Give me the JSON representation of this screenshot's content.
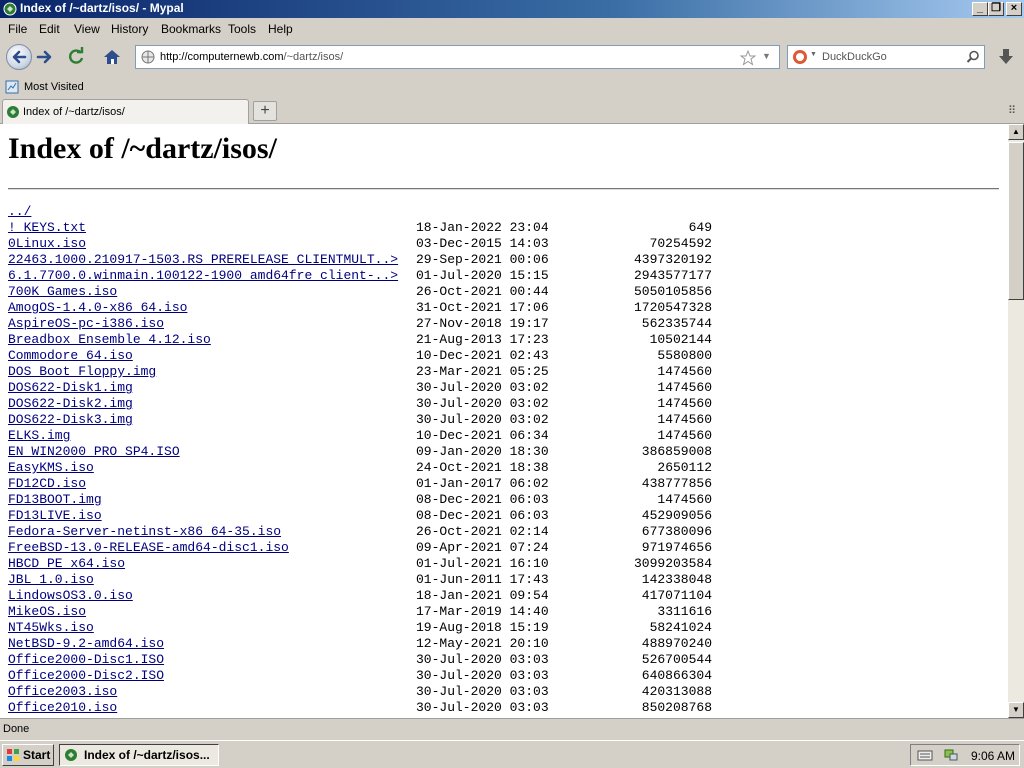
{
  "window": {
    "title": "Index of /~dartz/isos/ - Mypal"
  },
  "menu": [
    "File",
    "Edit",
    "View",
    "History",
    "Bookmarks",
    "Tools",
    "Help"
  ],
  "nav": {
    "url_host": "http://computernewb.com",
    "url_path": "/~dartz/isos/",
    "search_placeholder": "DuckDuckGo"
  },
  "bookmarks_bar": {
    "most_visited": "Most Visited"
  },
  "tab": {
    "title": "Index of /~dartz/isos/"
  },
  "page": {
    "heading": "Index of /~dartz/isos/",
    "parent_link": "../",
    "files": [
      {
        "name": "! KEYS.txt",
        "date": "18-Jan-2022 23:04",
        "size": "649"
      },
      {
        "name": "0Linux.iso",
        "date": "03-Dec-2015 14:03",
        "size": "70254592"
      },
      {
        "name": "22463.1000.210917-1503.RS_PRERELEASE_CLIENTMULT..>",
        "date": "29-Sep-2021 00:06",
        "size": "4397320192"
      },
      {
        "name": "6.1.7700.0.winmain.100122-1900_amd64fre_client-..>",
        "date": "01-Jul-2020 15:15",
        "size": "2943577177"
      },
      {
        "name": "700K Games.iso",
        "date": "26-Oct-2021 00:44",
        "size": "5050105856"
      },
      {
        "name": "AmogOS-1.4.0-x86_64.iso",
        "date": "31-Oct-2021 17:06",
        "size": "1720547328"
      },
      {
        "name": "AspireOS-pc-i386.iso",
        "date": "27-Nov-2018 19:17",
        "size": "562335744"
      },
      {
        "name": "Breadbox Ensemble 4.12.iso",
        "date": "21-Aug-2013 17:23",
        "size": "10502144"
      },
      {
        "name": "Commodore 64.iso",
        "date": "10-Dec-2021 02:43",
        "size": "5580800"
      },
      {
        "name": "DOS Boot Floppy.img",
        "date": "23-Mar-2021 05:25",
        "size": "1474560"
      },
      {
        "name": "DOS622-Disk1.img",
        "date": "30-Jul-2020 03:02",
        "size": "1474560"
      },
      {
        "name": "DOS622-Disk2.img",
        "date": "30-Jul-2020 03:02",
        "size": "1474560"
      },
      {
        "name": "DOS622-Disk3.img",
        "date": "30-Jul-2020 03:02",
        "size": "1474560"
      },
      {
        "name": "ELKS.img",
        "date": "10-Dec-2021 06:34",
        "size": "1474560"
      },
      {
        "name": "EN_WIN2000_PRO_SP4.ISO",
        "date": "09-Jan-2020 18:30",
        "size": "386859008"
      },
      {
        "name": "EasyKMS.iso",
        "date": "24-Oct-2021 18:38",
        "size": "2650112"
      },
      {
        "name": "FD12CD.iso",
        "date": "01-Jan-2017 06:02",
        "size": "438777856"
      },
      {
        "name": "FD13BOOT.img",
        "date": "08-Dec-2021 06:03",
        "size": "1474560"
      },
      {
        "name": "FD13LIVE.iso",
        "date": "08-Dec-2021 06:03",
        "size": "452909056"
      },
      {
        "name": "Fedora-Server-netinst-x86_64-35.iso",
        "date": "26-Oct-2021 02:14",
        "size": "677380096"
      },
      {
        "name": "FreeBSD-13.0-RELEASE-amd64-disc1.iso",
        "date": "09-Apr-2021 07:24",
        "size": "971974656"
      },
      {
        "name": "HBCD_PE_x64.iso",
        "date": "01-Jul-2021 16:10",
        "size": "3099203584"
      },
      {
        "name": "JBL 1.0.iso",
        "date": "01-Jun-2011 17:43",
        "size": "142338048"
      },
      {
        "name": "LindowsOS3.0.iso",
        "date": "18-Jan-2021 09:54",
        "size": "417071104"
      },
      {
        "name": "MikeOS.iso",
        "date": "17-Mar-2019 14:40",
        "size": "3311616"
      },
      {
        "name": "NT45Wks.iso",
        "date": "19-Aug-2018 15:19",
        "size": "58241024"
      },
      {
        "name": "NetBSD-9.2-amd64.iso",
        "date": "12-May-2021 20:10",
        "size": "488970240"
      },
      {
        "name": "Office2000-Disc1.ISO",
        "date": "30-Jul-2020 03:03",
        "size": "526700544"
      },
      {
        "name": "Office2000-Disc2.ISO",
        "date": "30-Jul-2020 03:03",
        "size": "640866304"
      },
      {
        "name": "Office2003.iso",
        "date": "30-Jul-2020 03:03",
        "size": "420313088"
      },
      {
        "name": "Office2010.iso",
        "date": "30-Jul-2020 03:03",
        "size": "850208768"
      }
    ]
  },
  "status": {
    "text": "Done"
  },
  "taskbar": {
    "start_label": "Start",
    "task_label": "Index of /~dartz/isos...",
    "clock": "9:06 AM"
  },
  "icons": {
    "app": "mypal-icon",
    "back": "back-arrow-icon",
    "forward": "forward-arrow-icon",
    "reload": "reload-icon",
    "home": "home-icon",
    "star": "star-icon",
    "search_engine": "duckduckgo-icon",
    "search": "magnifier-icon",
    "download": "download-icon"
  }
}
